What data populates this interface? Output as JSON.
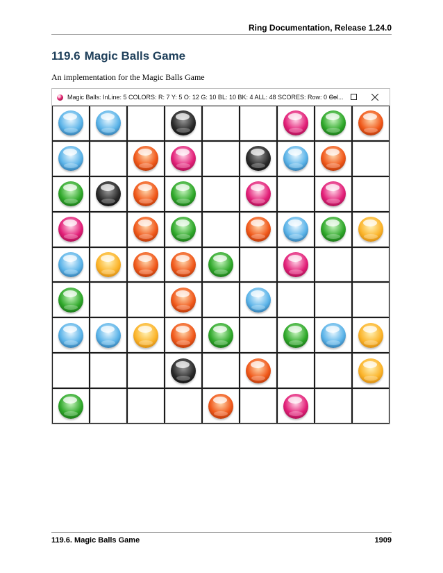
{
  "header": {
    "running_title": "Ring Documentation, Release 1.24.0"
  },
  "section": {
    "number": "119.6",
    "title": "Magic Balls Game"
  },
  "intro": "An implementation for the Magic Balls Game",
  "window": {
    "title": "Magic Balls: InLine: 5   COLORS: R: 7 Y: 5 O: 12 G: 10 BL: 10 BK: 4  ALL: 48    SCORES: Row: 0 Col...",
    "controls": [
      "minimize",
      "maximize",
      "close"
    ]
  },
  "colors": {
    "blue": {
      "light": "#e9f7ff",
      "mid": "#5ab3e8",
      "dark": "#164f80"
    },
    "black": {
      "light": "#9a9a9a",
      "mid": "#2a2a2a",
      "dark": "#000000"
    },
    "pink": {
      "light": "#ffd3e6",
      "mid": "#e21f78",
      "dark": "#7c0937"
    },
    "green": {
      "light": "#c8f5c0",
      "mid": "#2fa82a",
      "dark": "#0c4d0c"
    },
    "orange": {
      "light": "#ffd7ad",
      "mid": "#f0581a",
      "dark": "#8a2300"
    },
    "yellow": {
      "light": "#fff2b8",
      "mid": "#fbb42a",
      "dark": "#b86a00"
    }
  },
  "board": {
    "rows": [
      [
        "blue",
        "blue",
        "",
        "black",
        "",
        "",
        "pink",
        "green",
        "orange"
      ],
      [
        "blue",
        "",
        "orange",
        "pink",
        "",
        "black",
        "blue",
        "orange",
        ""
      ],
      [
        "green",
        "black",
        "orange",
        "green",
        "",
        "pink",
        "",
        "pink",
        ""
      ],
      [
        "pink",
        "",
        "orange",
        "green",
        "",
        "orange",
        "blue",
        "green",
        "yellow"
      ],
      [
        "blue",
        "yellow",
        "orange",
        "orange",
        "green",
        "",
        "pink",
        "",
        ""
      ],
      [
        "green",
        "",
        "",
        "orange",
        "",
        "blue",
        "",
        "",
        ""
      ],
      [
        "blue",
        "blue",
        "yellow",
        "orange",
        "green",
        "",
        "green",
        "blue",
        "yellow"
      ],
      [
        "",
        "",
        "",
        "black",
        "",
        "orange",
        "",
        "",
        "yellow"
      ],
      [
        "green",
        "",
        "",
        "",
        "orange",
        "",
        "pink",
        "",
        ""
      ]
    ]
  },
  "footer": {
    "section_label": "119.6.  Magic Balls Game",
    "page_number": "1909"
  }
}
